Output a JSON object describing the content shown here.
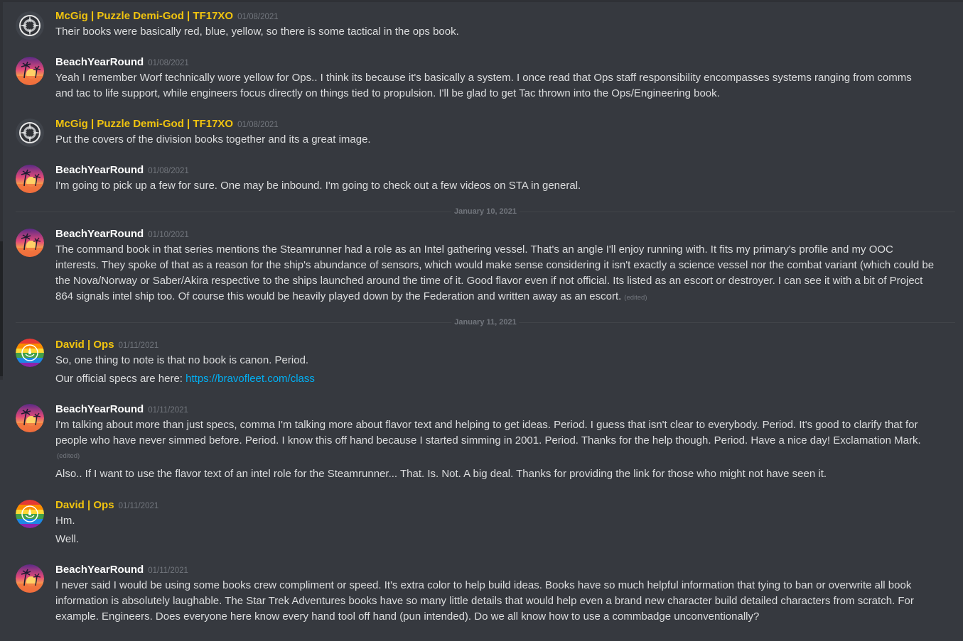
{
  "users": {
    "mcgig": {
      "name": "McGig | Puzzle Demi-God | TF17XO",
      "name_color": "#f1c40f"
    },
    "beach": {
      "name": "BeachYearRound",
      "name_color": "#ffffff"
    },
    "david": {
      "name": "David | Ops",
      "name_color": "#f1c40f"
    }
  },
  "colors": {
    "background": "#36393f",
    "text": "#dcddde",
    "muted": "#72767d",
    "link": "#00b0f4",
    "role_gold": "#f1c40f"
  },
  "messages": [
    {
      "author": "McGig | Puzzle Demi-God | TF17XO",
      "avatar": "compass-avatar",
      "timestamp": "01/08/2021",
      "lines": [
        "Their books were basically red, blue, yellow, so there is some tactical in the ops book."
      ]
    },
    {
      "author": "BeachYearRound",
      "avatar": "sunset-palm-avatar",
      "timestamp": "01/08/2021",
      "lines": [
        "Yeah I remember Worf technically wore yellow for Ops.. I think its because it's basically a system. I once read that Ops staff responsibility encompasses systems ranging from comms",
        "and tac to life support, while engineers focus directly on things tied to propulsion. I'll be glad to get Tac thrown into the Ops/Engineering book."
      ]
    },
    {
      "author": "McGig | Puzzle Demi-God | TF17XO",
      "avatar": "compass-avatar",
      "timestamp": "01/08/2021",
      "lines": [
        "Put the covers of the division books together and its a great image."
      ]
    },
    {
      "author": "BeachYearRound",
      "avatar": "sunset-palm-avatar",
      "timestamp": "01/08/2021",
      "lines": [
        "I'm going to pick up a few for sure. One may be inbound. I'm going to check out a few videos on STA in general."
      ]
    },
    {
      "author": "BeachYearRound",
      "avatar": "sunset-palm-avatar",
      "timestamp": "01/10/2021",
      "lines": [
        "The command book in that series mentions the Steamrunner had a role as an Intel gathering vessel. That's an angle I'll enjoy running with. It fits my primary's profile and my OOC",
        "interests. They spoke of that as a reason for the ship's abundance of sensors, which would make sense considering it isn't exactly a science vessel nor the combat variant (which could be",
        "the Nova/Norway or Saber/Akira respective to the ships launched around the time of it. Good flavor even if not official. Its listed as an escort or destroyer. I can see it with a bit of Project",
        "864 signals intel ship too. Of course this would be heavily played down by the Federation and written away as an escort."
      ],
      "edited": "(edited)"
    },
    {
      "author": "David | Ops",
      "avatar": "rainbow-emblem-avatar",
      "timestamp": "01/11/2021",
      "lines": [
        "So, one thing to note is that no book is canon. Period."
      ],
      "followup_prefix": "Our official specs are here: ",
      "followup_link": "https://bravofleet.com/class"
    },
    {
      "author": "BeachYearRound",
      "avatar": "sunset-palm-avatar",
      "timestamp": "01/11/2021",
      "lines": [
        "I'm talking about more than just specs, comma I'm talking more about flavor text and helping to get ideas. Period. I guess that isn't clear to everybody. Period. It's good to clarify that for",
        "people who have never simmed before. Period. I know this off hand because I started simming in 2001. Period. Thanks for the help though. Period. Have a nice day! Exclamation Mark."
      ],
      "edited": "(edited)",
      "followup": "Also.. If I want to use the flavor text of an intel role for the Steamrunner... That. Is. Not. A big deal. Thanks for providing the link for those who might not have seen it."
    },
    {
      "author": "David | Ops",
      "avatar": "rainbow-emblem-avatar",
      "timestamp": "01/11/2021",
      "lines": [
        "Hm."
      ],
      "followup": "Well."
    },
    {
      "author": "BeachYearRound",
      "avatar": "sunset-palm-avatar",
      "timestamp": "01/11/2021",
      "lines": [
        "I never said I would be using some books crew compliment or speed. It's extra color to help build ideas. Books have so much helpful information that tying to ban or overwrite all book",
        "information is absolutely laughable. The Star Trek Adventures books have so many little details that would help even a brand new character build detailed characters from scratch. For",
        "example. Engineers. Does everyone here know every hand tool off hand (pun intended). Do we all know how to use a commbadge unconventionally?"
      ]
    }
  ],
  "dividers": [
    "January 10, 2021",
    "January 11, 2021"
  ]
}
